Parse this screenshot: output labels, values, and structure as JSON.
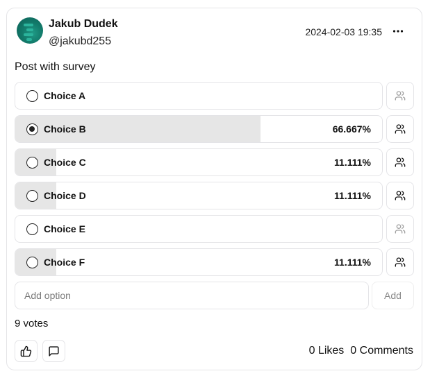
{
  "author": {
    "name": "Jakub Dudek",
    "handle": "@jakubd255",
    "timestamp": "2024-02-03 19:35"
  },
  "post": {
    "text": "Post with survey"
  },
  "survey": {
    "options": [
      {
        "label": "Choice A",
        "percent_text": "",
        "percent": 0,
        "selected": false,
        "voters_enabled": false
      },
      {
        "label": "Choice B",
        "percent_text": "66.667%",
        "percent": 66.667,
        "selected": true,
        "voters_enabled": true
      },
      {
        "label": "Choice C",
        "percent_text": "11.111%",
        "percent": 11.111,
        "selected": false,
        "voters_enabled": true
      },
      {
        "label": "Choice D",
        "percent_text": "11.111%",
        "percent": 11.111,
        "selected": false,
        "voters_enabled": true
      },
      {
        "label": "Choice E",
        "percent_text": "",
        "percent": 0,
        "selected": false,
        "voters_enabled": false
      },
      {
        "label": "Choice F",
        "percent_text": "11.111%",
        "percent": 11.111,
        "selected": false,
        "voters_enabled": true
      }
    ],
    "add_option_placeholder": "Add option",
    "add_button_label": "Add",
    "votes_label": "9 votes"
  },
  "footer": {
    "likes_label": "0 Likes",
    "comments_label": "0 Comments"
  },
  "icons": {
    "more": "more-horizontal-icon",
    "voters": "users-icon",
    "like": "thumbs-up-icon",
    "comment": "message-square-icon"
  },
  "colors": {
    "result_fill": "#e6e6e6",
    "border": "#e4e4e7",
    "avatar": "#127a6a"
  }
}
